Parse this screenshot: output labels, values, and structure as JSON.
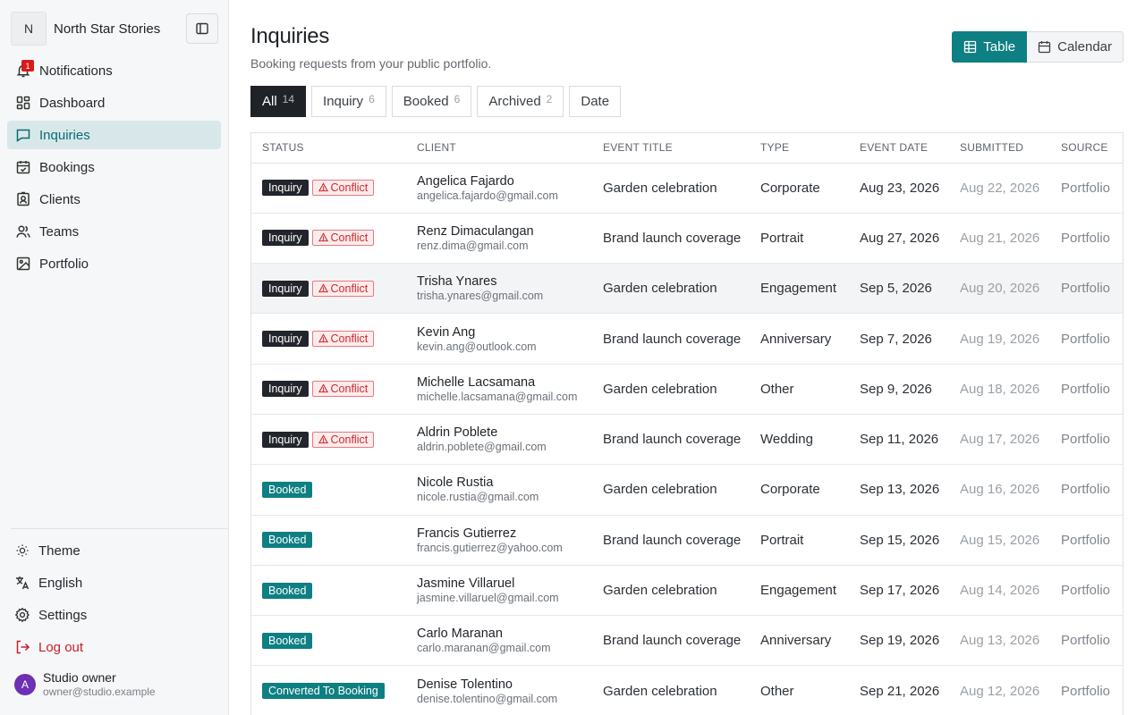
{
  "sidebar": {
    "brand_initial": "N",
    "brand_name": "North Star Stories",
    "notification_count": "1",
    "nav": [
      {
        "label": "Notifications",
        "icon": "bell-icon"
      },
      {
        "label": "Dashboard",
        "icon": "dashboard-icon"
      },
      {
        "label": "Inquiries",
        "icon": "message-icon",
        "active": true
      },
      {
        "label": "Bookings",
        "icon": "calendar-check-icon"
      },
      {
        "label": "Clients",
        "icon": "contact-icon"
      },
      {
        "label": "Teams",
        "icon": "users-icon"
      },
      {
        "label": "Portfolio",
        "icon": "image-icon"
      }
    ],
    "bottom": [
      {
        "label": "Theme",
        "icon": "sun-icon"
      },
      {
        "label": "English",
        "icon": "language-icon"
      },
      {
        "label": "Settings",
        "icon": "gear-icon"
      },
      {
        "label": "Log out",
        "icon": "logout-icon"
      }
    ],
    "user": {
      "initial": "A",
      "name": "Studio owner",
      "email": "owner@studio.example"
    }
  },
  "header": {
    "title": "Inquiries",
    "subtitle": "Booking requests from your public portfolio.",
    "views": [
      "Table",
      "Calendar"
    ],
    "active_view": "Table"
  },
  "filters": [
    {
      "label": "All",
      "count": "14",
      "active": true
    },
    {
      "label": "Inquiry",
      "count": "6"
    },
    {
      "label": "Booked",
      "count": "6"
    },
    {
      "label": "Archived",
      "count": "2"
    },
    {
      "label": "Date",
      "count": ""
    }
  ],
  "table": {
    "columns": [
      "STATUS",
      "CLIENT",
      "EVENT TITLE",
      "TYPE",
      "EVENT DATE",
      "SUBMITTED",
      "SOURCE"
    ],
    "conflict_label": "Conflict",
    "rows": [
      {
        "status": "Inquiry",
        "conflict": true,
        "name": "Angelica Fajardo",
        "email": "angelica.fajardo@gmail.com",
        "event": "Garden celebration",
        "type": "Corporate",
        "date": "Aug 23, 2026",
        "submitted": "Aug 22, 2026",
        "source": "Portfolio"
      },
      {
        "status": "Inquiry",
        "conflict": true,
        "name": "Renz Dimaculangan",
        "email": "renz.dima@gmail.com",
        "event": "Brand launch coverage",
        "type": "Portrait",
        "date": "Aug 27, 2026",
        "submitted": "Aug 21, 2026",
        "source": "Portfolio"
      },
      {
        "status": "Inquiry",
        "conflict": true,
        "name": "Trisha Ynares",
        "email": "trisha.ynares@gmail.com",
        "event": "Garden celebration",
        "type": "Engagement",
        "date": "Sep 5, 2026",
        "submitted": "Aug 20, 2026",
        "source": "Portfolio",
        "highlight": true
      },
      {
        "status": "Inquiry",
        "conflict": true,
        "name": "Kevin Ang",
        "email": "kevin.ang@outlook.com",
        "event": "Brand launch coverage",
        "type": "Anniversary",
        "date": "Sep 7, 2026",
        "submitted": "Aug 19, 2026",
        "source": "Portfolio"
      },
      {
        "status": "Inquiry",
        "conflict": true,
        "name": "Michelle Lacsamana",
        "email": "michelle.lacsamana@gmail.com",
        "event": "Garden celebration",
        "type": "Other",
        "date": "Sep 9, 2026",
        "submitted": "Aug 18, 2026",
        "source": "Portfolio"
      },
      {
        "status": "Inquiry",
        "conflict": true,
        "name": "Aldrin Poblete",
        "email": "aldrin.poblete@gmail.com",
        "event": "Brand launch coverage",
        "type": "Wedding",
        "date": "Sep 11, 2026",
        "submitted": "Aug 17, 2026",
        "source": "Portfolio"
      },
      {
        "status": "Booked",
        "conflict": false,
        "name": "Nicole Rustia",
        "email": "nicole.rustia@gmail.com",
        "event": "Garden celebration",
        "type": "Corporate",
        "date": "Sep 13, 2026",
        "submitted": "Aug 16, 2026",
        "source": "Portfolio"
      },
      {
        "status": "Booked",
        "conflict": false,
        "name": "Francis Gutierrez",
        "email": "francis.gutierrez@yahoo.com",
        "event": "Brand launch coverage",
        "type": "Portrait",
        "date": "Sep 15, 2026",
        "submitted": "Aug 15, 2026",
        "source": "Portfolio"
      },
      {
        "status": "Booked",
        "conflict": false,
        "name": "Jasmine Villaruel",
        "email": "jasmine.villaruel@gmail.com",
        "event": "Garden celebration",
        "type": "Engagement",
        "date": "Sep 17, 2026",
        "submitted": "Aug 14, 2026",
        "source": "Portfolio"
      },
      {
        "status": "Booked",
        "conflict": false,
        "name": "Carlo Maranan",
        "email": "carlo.maranan@gmail.com",
        "event": "Brand launch coverage",
        "type": "Anniversary",
        "date": "Sep 19, 2026",
        "submitted": "Aug 13, 2026",
        "source": "Portfolio"
      },
      {
        "status": "Converted To Booking",
        "conflict": false,
        "name": "Denise Tolentino",
        "email": "denise.tolentino@gmail.com",
        "event": "Garden celebration",
        "type": "Other",
        "date": "Sep 21, 2026",
        "submitted": "Aug 12, 2026",
        "source": "Portfolio"
      }
    ]
  },
  "colors": {
    "accent": "#0e7f82",
    "danger": "#d0282f",
    "dark": "#1f2227"
  }
}
